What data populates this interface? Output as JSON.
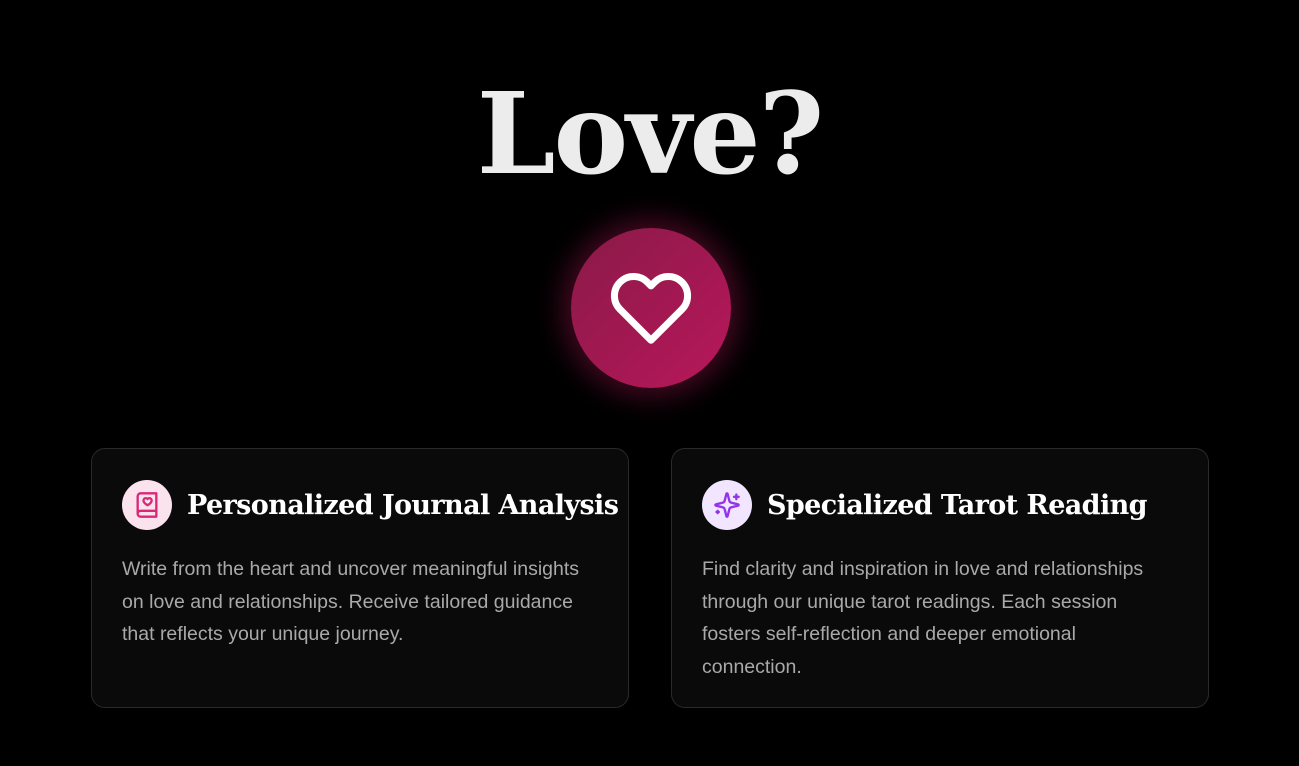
{
  "hero": {
    "title": "Love?",
    "icon": "heart-icon",
    "accent_color": "#b8175a"
  },
  "features": [
    {
      "icon": "journal-book-heart-icon",
      "icon_color": "#db2777",
      "title": "Personalized Journal Analysis",
      "description": "Write from the heart and uncover meaningful insights on love and relationships. Receive tailored guidance that reflects your unique journey."
    },
    {
      "icon": "sparkles-icon",
      "icon_color": "#9333ea",
      "title": "Specialized Tarot Reading",
      "description": "Find clarity and inspiration in love and relationships through our unique tarot readings. Each session fosters self-reflection and deeper emotional connection."
    }
  ]
}
